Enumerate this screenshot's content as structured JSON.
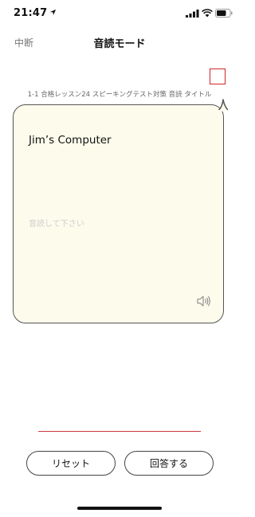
{
  "status_bar": {
    "time": "21:47"
  },
  "nav": {
    "back_label": "中断",
    "title": "音読モード"
  },
  "lesson": {
    "title": "1-1 合格レッスン24 スピーキングテスト対策 音読 タイトル"
  },
  "card": {
    "prompt": "Jim’s Computer",
    "placeholder": "音読して下さい"
  },
  "buttons": {
    "reset": "リセット",
    "answer": "回答する"
  },
  "colors": {
    "accent_red": "#d0262b",
    "bubble_bg": "#fcfbec"
  }
}
